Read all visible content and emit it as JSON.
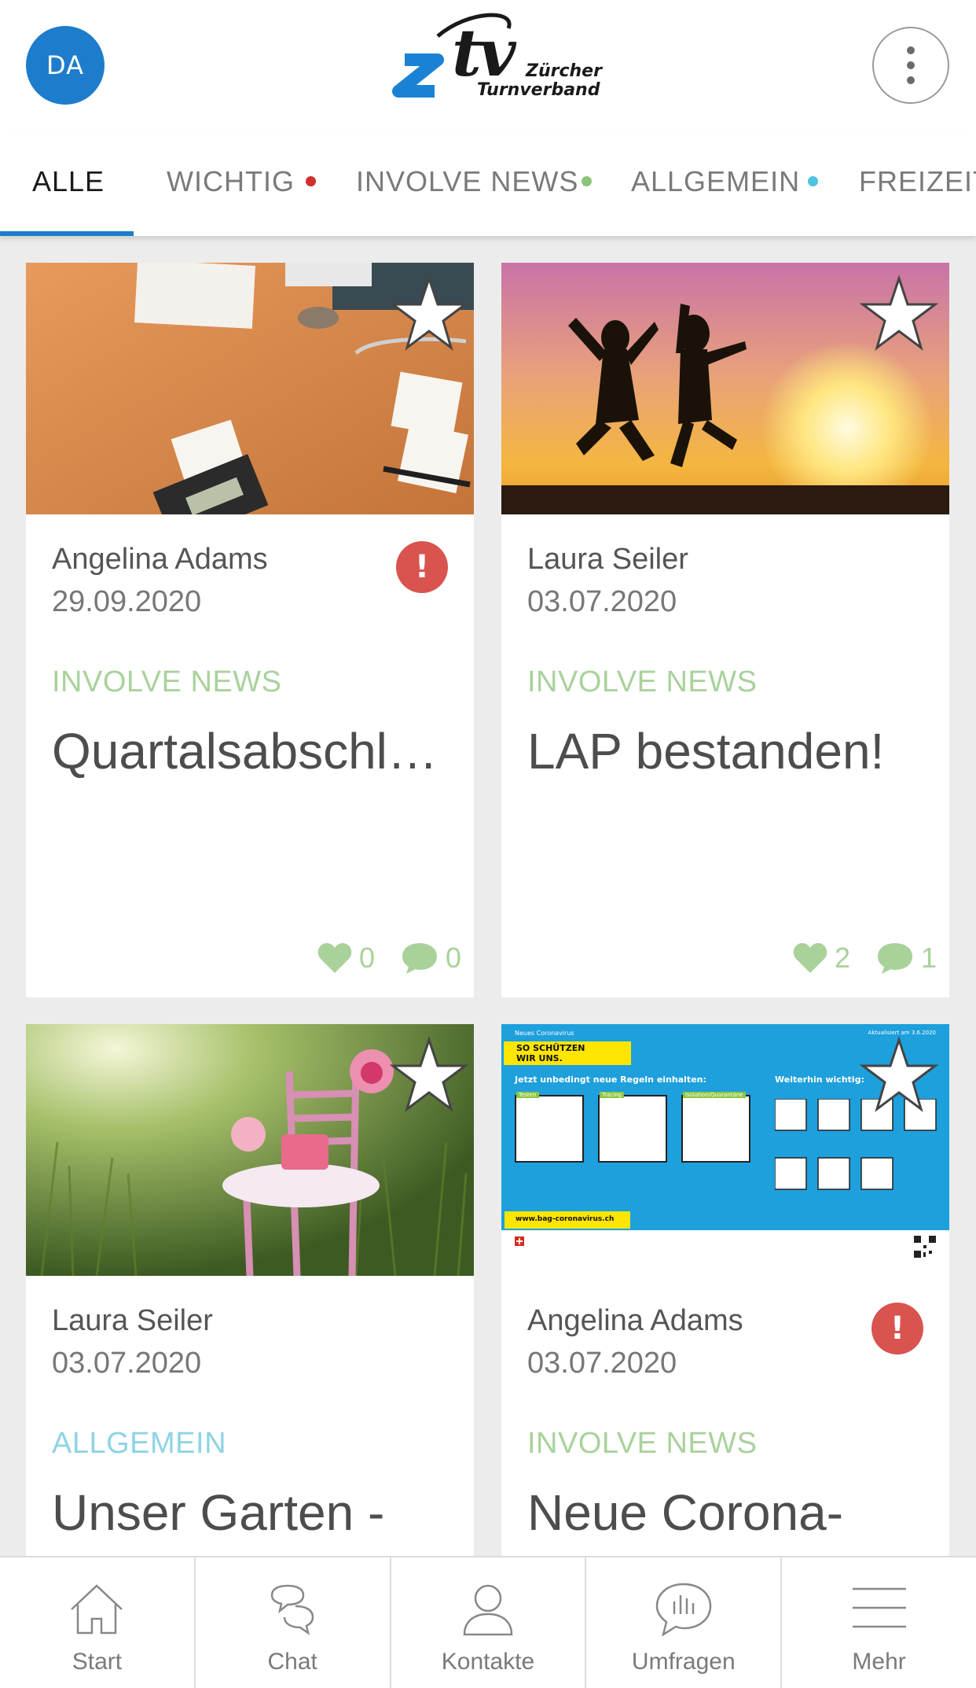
{
  "header": {
    "avatar_initials": "DA",
    "logo": {
      "mark": "z",
      "tv": "tv",
      "line1": "Zürcher",
      "line2": "Turnverband"
    },
    "menu_icon": "more-vertical-icon"
  },
  "tabs": [
    {
      "label": "ALLE",
      "active": true
    },
    {
      "label": "WICHTIG",
      "dot_color": "#d0312d"
    },
    {
      "label": "INVOLVE NEWS",
      "dot_color": "#8cc57a"
    },
    {
      "label": "ALLGEMEIN",
      "dot_color": "#4fc3e0"
    },
    {
      "label": "FREIZEIT"
    }
  ],
  "colors": {
    "accent": "#1e7ccc",
    "involve_news": "#a9d29b",
    "allgemein": "#8fd3e6",
    "alert": "#d9534f"
  },
  "cards": [
    {
      "author": "Angelina Adams",
      "date": "29.09.2020",
      "category": "INVOLVE NEWS",
      "title": "Quartalsabschluss",
      "important": true,
      "alert_symbol": "!",
      "likes": "0",
      "comments": "0",
      "image": "desk-with-calculator"
    },
    {
      "author": "Laura Seiler",
      "date": "03.07.2020",
      "category": "INVOLVE NEWS",
      "title": "LAP bestanden!",
      "important": false,
      "likes": "2",
      "comments": "1",
      "image": "people-jumping-sunset"
    },
    {
      "author": "Laura Seiler",
      "date": "03.07.2020",
      "category": "ALLGEMEIN",
      "title": "Unser Garten -",
      "important": false,
      "image": "pink-chair-in-garden"
    },
    {
      "author": "Angelina Adams",
      "date": "03.07.2020",
      "category": "INVOLVE NEWS",
      "title": "Neue Corona-",
      "important": true,
      "alert_symbol": "!",
      "image": "coronavirus-poster",
      "poster": {
        "top_left": "Neues Coronavirus",
        "top_right": "Aktualisiert am 3.6.2020",
        "badge_line1": "SO SCHÜTZEN",
        "badge_line2": "WIR UNS.",
        "heading_left": "Jetzt unbedingt neue Regeln einhalten:",
        "heading_right": "Weiterhin wichtig:",
        "box1": "Testen",
        "box2": "Tracing",
        "box3": "Isolation/Quarantäne",
        "url": "www.bag-coronavirus.ch"
      }
    }
  ],
  "bottom_nav": [
    {
      "label": "Start",
      "icon": "home-icon"
    },
    {
      "label": "Chat",
      "icon": "chat-icon"
    },
    {
      "label": "Kontakte",
      "icon": "contact-icon"
    },
    {
      "label": "Umfragen",
      "icon": "survey-icon"
    },
    {
      "label": "Mehr",
      "icon": "menu-icon"
    }
  ]
}
